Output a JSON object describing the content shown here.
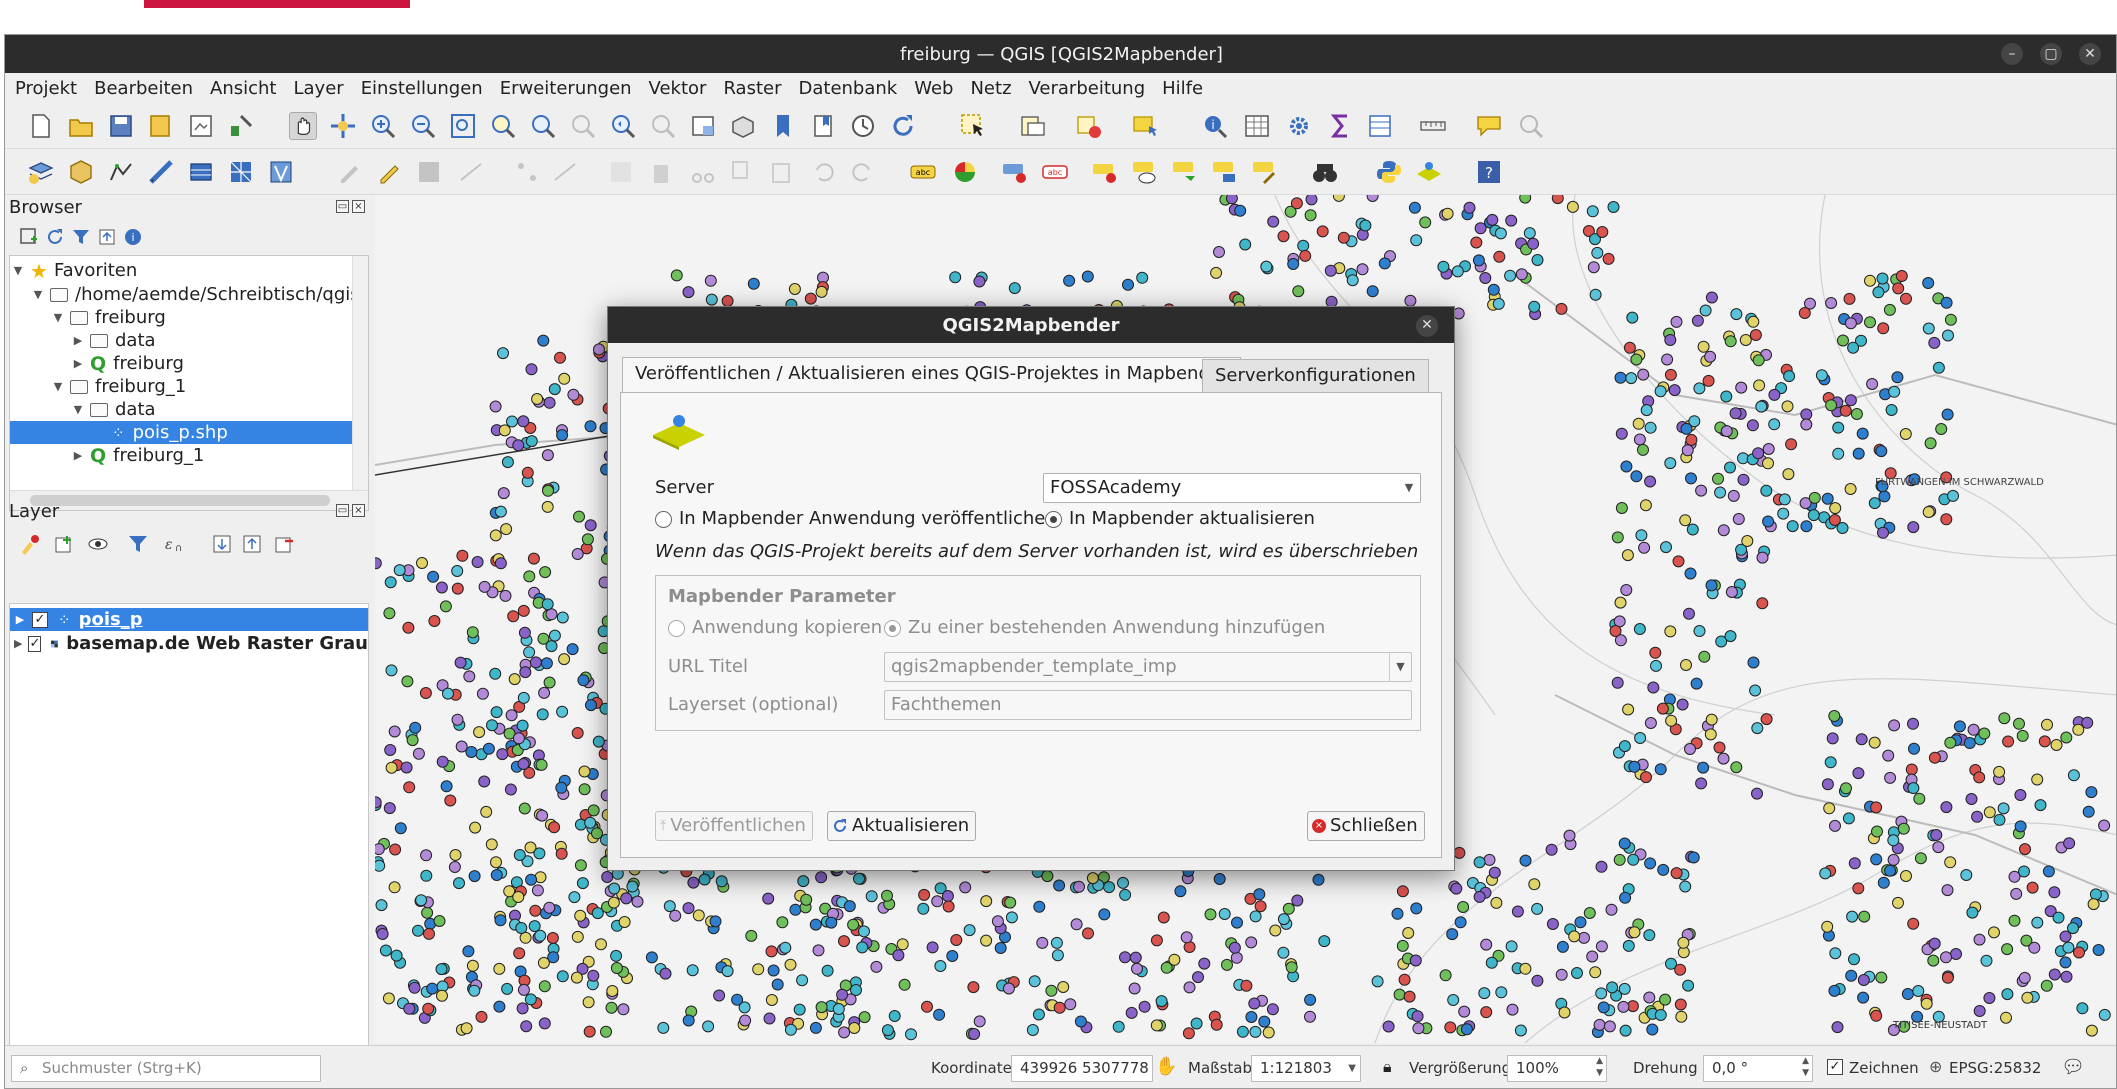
{
  "window": {
    "title": "freiburg — QGIS [QGIS2Mapbender]",
    "controls": [
      "–",
      "▢",
      "✕"
    ]
  },
  "menubar": {
    "items": [
      "Projekt",
      "Bearbeiten",
      "Ansicht",
      "Layer",
      "Einstellungen",
      "Erweiterungen",
      "Vektor",
      "Raster",
      "Datenbank",
      "Web",
      "Netz",
      "Verarbeitung",
      "Hilfe"
    ]
  },
  "browser": {
    "title": "Browser",
    "items": [
      {
        "label": "Favoriten",
        "type": "star"
      },
      {
        "label": "/home/aemde/Schreibtisch/qgise",
        "type": "folder"
      },
      {
        "label": "freiburg",
        "type": "folder"
      },
      {
        "label": "data",
        "type": "folder"
      },
      {
        "label": "freiburg",
        "type": "qgis"
      },
      {
        "label": "freiburg_1",
        "type": "folder"
      },
      {
        "label": "data",
        "type": "folder"
      },
      {
        "label": "pois_p.shp",
        "type": "shp"
      },
      {
        "label": "freiburg_1",
        "type": "qgis"
      }
    ]
  },
  "layers": {
    "title": "Layer",
    "items": [
      {
        "label": "pois_p",
        "checked": true
      },
      {
        "label": "basemap.de Web Raster Grau",
        "checked": true
      }
    ]
  },
  "map_labels": {
    "furtwangen": "FURTWANGEN IM SCHWARZWALD",
    "neustadt": "TITISEE-NEUSTADT"
  },
  "dialog": {
    "title": "QGIS2Mapbender",
    "tabs": [
      "Veröffentlichen / Aktualisieren eines QGIS-Projektes in Mapbender",
      "Serverkonfigurationen"
    ],
    "server_label": "Server",
    "server_value": "FOSSAcademy",
    "radio_publish": "In Mapbender Anwendung veröffentlichen",
    "radio_update": "In Mapbender aktualisieren",
    "warning": "Wenn das QGIS-Projekt bereits auf dem Server vorhanden ist, wird es überschrieben",
    "params": {
      "title": "Mapbender Parameter",
      "radio_copy": "Anwendung kopieren",
      "radio_add": "Zu einer bestehenden Anwendung hinzufügen",
      "url_label": "URL Titel",
      "url_value": "qgis2mapbender_template_imp",
      "layerset_label": "Layerset (optional)",
      "layerset_value": "Fachthemen"
    },
    "btn_publish": "Veröffentlichen",
    "btn_update": "Aktualisieren",
    "btn_close": "Schließen"
  },
  "statusbar": {
    "search_placeholder": "Suchmuster (Strg+K)",
    "coord_label": "Koordinate",
    "coord_value": "439926  5307778",
    "scale_label": "Maßstab",
    "scale_value": "1:121803",
    "zoom_label": "Vergrößerung",
    "zoom_value": "100%",
    "rotation_label": "Drehung",
    "rotation_value": "0,0 °",
    "render_label": "Zeichnen",
    "crs": "EPSG:25832"
  },
  "colors": {
    "accent": "#3584e4",
    "titlebar": "#2c2c2c",
    "brand_bar": "#cc1540"
  }
}
